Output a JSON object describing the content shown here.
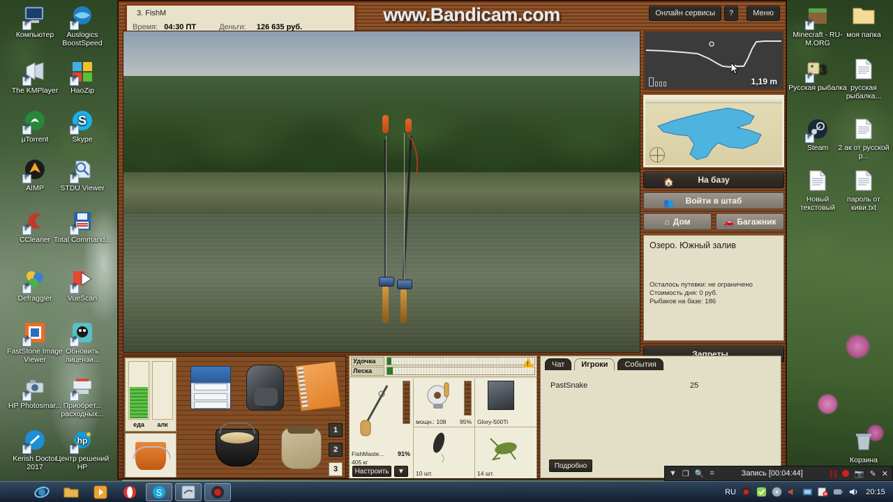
{
  "desktop": {
    "left_icons": [
      {
        "label": "Компьютер",
        "icon": "computer-icon"
      },
      {
        "label": "Auslogics BoostSpeed",
        "icon": "auslogics-icon"
      },
      {
        "label": "The KMPlayer",
        "icon": "kmplayer-icon"
      },
      {
        "label": "HaoZip",
        "icon": "haozip-icon"
      },
      {
        "label": "µTorrent",
        "icon": "utorrent-icon"
      },
      {
        "label": "Skype",
        "icon": "skype-icon"
      },
      {
        "label": "AIMP",
        "icon": "aimp-icon"
      },
      {
        "label": "STDU Viewer",
        "icon": "stdu-viewer-icon"
      },
      {
        "label": "CCleaner",
        "icon": "ccleaner-icon"
      },
      {
        "label": "Total Command...",
        "icon": "total-commander-icon"
      },
      {
        "label": "Defraggler",
        "icon": "defraggler-icon"
      },
      {
        "label": "VueScan",
        "icon": "vuescan-icon"
      },
      {
        "label": "FastStone Image Viewer",
        "icon": "faststone-icon"
      },
      {
        "label": "Обновить лицензи...",
        "icon": "license-update-icon"
      },
      {
        "label": "HP Photosmar...",
        "icon": "hp-photosmart-icon"
      },
      {
        "label": "Приобрет... расходных...",
        "icon": "hp-supplies-icon"
      },
      {
        "label": "Kerish Doctor 2017",
        "icon": "kerish-doctor-icon"
      },
      {
        "label": "Центр решений HP",
        "icon": "hp-solution-center-icon"
      }
    ],
    "right_icons": [
      {
        "label": "Minecraft - RU-M.ORG",
        "icon": "minecraft-icon"
      },
      {
        "label": "моя папка",
        "icon": "folder-icon"
      },
      {
        "label": "Русская рыбалка",
        "icon": "russian-fishing-3-icon"
      },
      {
        "label": "русская рыбалка...",
        "icon": "text-file-icon"
      },
      {
        "label": "Steam",
        "icon": "steam-icon"
      },
      {
        "label": "2 ак от русской р...",
        "icon": "text-file-icon"
      },
      {
        "label": "Новый текстовый",
        "icon": "text-file-icon"
      },
      {
        "label": "пароль от киви.txt",
        "icon": "text-file-icon"
      },
      {
        "label": "Корзина",
        "icon": "recycle-bin-icon"
      }
    ]
  },
  "game": {
    "watermark": "www.Bandicam.com",
    "info": {
      "session": "3. FishM",
      "time_label": "Время:",
      "time_value": "04:30 ПТ",
      "money_label": "Деньги:",
      "money_value": "126 635 руб."
    },
    "topbuttons": {
      "online": "Онлайн сервисы",
      "help": "?",
      "menu": "Меню"
    },
    "depth": {
      "value": "1,19 m"
    },
    "actions": {
      "to_base": "На базу",
      "enter_hq": "Войти в штаб",
      "home": "Дом",
      "trunk": "Багажник",
      "restrictions": "Запреты..."
    },
    "location": {
      "title": "Озеро. Южный залив",
      "tickets": "Осталось путевки: не ограничено",
      "day_cost": "Стоимость дня: 0 руб.",
      "anglers": "Рыбаков на базе: 186"
    },
    "gauges": [
      {
        "label": "Удочка",
        "percent": 3
      },
      {
        "label": "Леска",
        "percent": 4
      }
    ],
    "inventory": {
      "food_label": "еда",
      "alc_label": "алк",
      "food_percent": 55,
      "alc_percent": 0,
      "items": [
        "tacklebox-icon",
        "backpack-icon",
        "notebook-icon",
        "cooking-pot-icon",
        "sack-icon",
        "bucket-icon"
      ],
      "slots": [
        "1",
        "2",
        "3"
      ],
      "active_slot": "3"
    },
    "tackle": {
      "rod_name": "FishMaste...",
      "rod_weight": "405 кг",
      "rod_percent": "91%",
      "reel_power": "мощн.: 108",
      "reel_percent": "95%",
      "line_name": "Glory-500Ti",
      "bait1_count": "10 шт.",
      "bait2_count": "14 шт.",
      "configure_button": "Настроить",
      "dropdown_button": "▼"
    },
    "chat": {
      "tabs": [
        {
          "label": "Чат",
          "active": false
        },
        {
          "label": "Игроки",
          "active": true
        },
        {
          "label": "События",
          "active": false
        }
      ],
      "players": [
        {
          "nick": "PastSnake",
          "level": "25"
        }
      ],
      "details_button": "Подробно"
    }
  },
  "bandicam": {
    "record_text": "Запись [00:04:44]",
    "buttons": [
      "collapse-icon",
      "window-icon",
      "zoom-icon",
      "region-icon",
      "pause-icon",
      "record-icon",
      "screenshot-icon",
      "draw-icon",
      "close-icon"
    ]
  },
  "taskbar": {
    "start": "start-orb-icon",
    "buttons": [
      "internet-explorer-icon",
      "explorer-icon",
      "media-player-icon",
      "opera-icon",
      "skype-icon",
      "game-icon",
      "bandicam-icon"
    ],
    "language": "RU",
    "tray": [
      "bandicam-tray-icon",
      "shield-ok-icon",
      "disc-icon",
      "volume-mute-icon",
      "network-icon",
      "antivirus-icon",
      "flash-icon",
      "volume-icon"
    ],
    "clock": "20:15"
  },
  "colors": {
    "wood": "#7a4117",
    "panel": "#e3dfc6",
    "accent": "#8d2f14"
  }
}
